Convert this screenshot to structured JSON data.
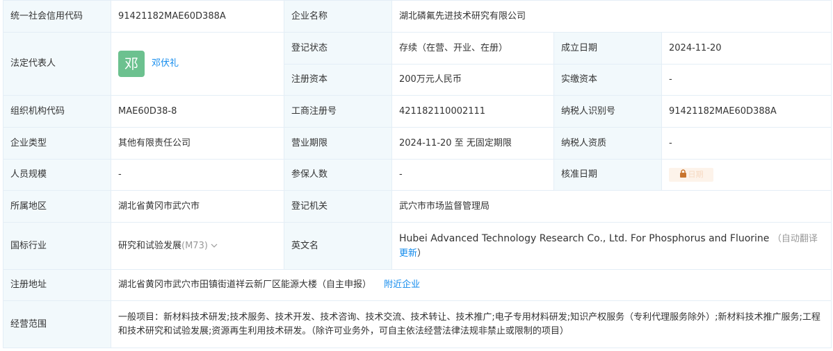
{
  "rows": {
    "credit_code": {
      "label": "统一社会信用代码",
      "value": "91421182MAE60D388A"
    },
    "company_name": {
      "label": "企业名称",
      "value": "湖北磷氟先进技术研究有限公司"
    },
    "legal_rep": {
      "label": "法定代表人",
      "avatar_char": "邓",
      "name": "邓伏礼"
    },
    "reg_status": {
      "label": "登记状态",
      "value": "存续（在营、开业、在册）"
    },
    "established": {
      "label": "成立日期",
      "value": "2024-11-20"
    },
    "reg_capital": {
      "label": "注册资本",
      "value": "200万元人民币"
    },
    "paid_capital": {
      "label": "实缴资本",
      "value": "-"
    },
    "org_code": {
      "label": "组织机构代码",
      "value": "MAE60D38-8"
    },
    "biz_reg_no": {
      "label": "工商注册号",
      "value": "421182110002111"
    },
    "taxpayer_id": {
      "label": "纳税人识别号",
      "value": "91421182MAE60D388A"
    },
    "company_type": {
      "label": "企业类型",
      "value": "其他有限责任公司"
    },
    "biz_term": {
      "label": "营业期限",
      "value": "2024-11-20 至 无固定期限"
    },
    "taxpayer_qual": {
      "label": "纳税人资质",
      "value": "-"
    },
    "staff_size": {
      "label": "人员规模",
      "value": "-"
    },
    "insured": {
      "label": "参保人数",
      "value": "-"
    },
    "approval_date": {
      "label": "核准日期",
      "locked_text": "日期"
    },
    "region": {
      "label": "所属地区",
      "value": "湖北省黄冈市武穴市"
    },
    "reg_authority": {
      "label": "登记机关",
      "value": "武穴市市场监督管理局"
    },
    "industry": {
      "label": "国标行业",
      "value": "研究和试验发展",
      "code": "(M73)"
    },
    "english_name": {
      "label": "英文名",
      "value": "Hubei Advanced Technology Research Co., Ltd. For Phosphorus and Fluorine",
      "auto_translate": "（自动翻译",
      "more_link": "更新",
      "close_paren": "）"
    },
    "address": {
      "label": "注册地址",
      "value": "湖北省黄冈市武穴市田镇街道祥云新厂区能源大楼（自主申报）",
      "nearby_link": "附近企业"
    },
    "scope": {
      "label": "经营范围",
      "value": "一般项目：新材料技术研发;技术服务、技术开发、技术咨询、技术交流、技术转让、技术推广;电子专用材料研发;知识产权服务（专利代理服务除外）;新材料技术推广服务;工程和技术研究和试验发展;资源再生利用技术研发。（除许可业务外，可自主依法经营法律法规非禁止或限制的项目）"
    }
  },
  "colors": {
    "label_bg": "#f2f9fc",
    "border": "#e4eef6",
    "link": "#128bed",
    "avatar": "#6cc18f",
    "lock": "#c8742e"
  },
  "icons": {
    "industry_toggle": "chevron-down-icon",
    "approval_lock": "lock-icon"
  }
}
